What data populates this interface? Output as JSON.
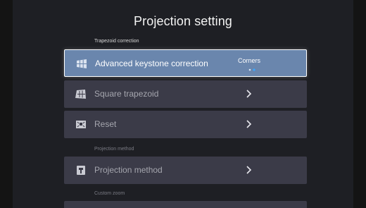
{
  "page": {
    "title": "Projection setting"
  },
  "sections": {
    "trapezoid_label": "Trapezoid correction",
    "projection_label": "Projection method",
    "zoom_label": "Custom zoom"
  },
  "rows": {
    "advanced": {
      "label": "Advanced keystone correction",
      "value": "Corners",
      "icon": "keystone-grid-icon"
    },
    "square": {
      "label": "Square trapezoid",
      "icon": "square-trapezoid-icon"
    },
    "reset": {
      "label": "Reset",
      "icon": "reset-icon"
    },
    "projection": {
      "label": "Projection method",
      "icon": "projector-icon"
    }
  },
  "colors": {
    "background": "#1e1f24",
    "row": "#3b3b48",
    "row_focused": "#6a86ad",
    "accent_dot": "#3aa7ff"
  }
}
